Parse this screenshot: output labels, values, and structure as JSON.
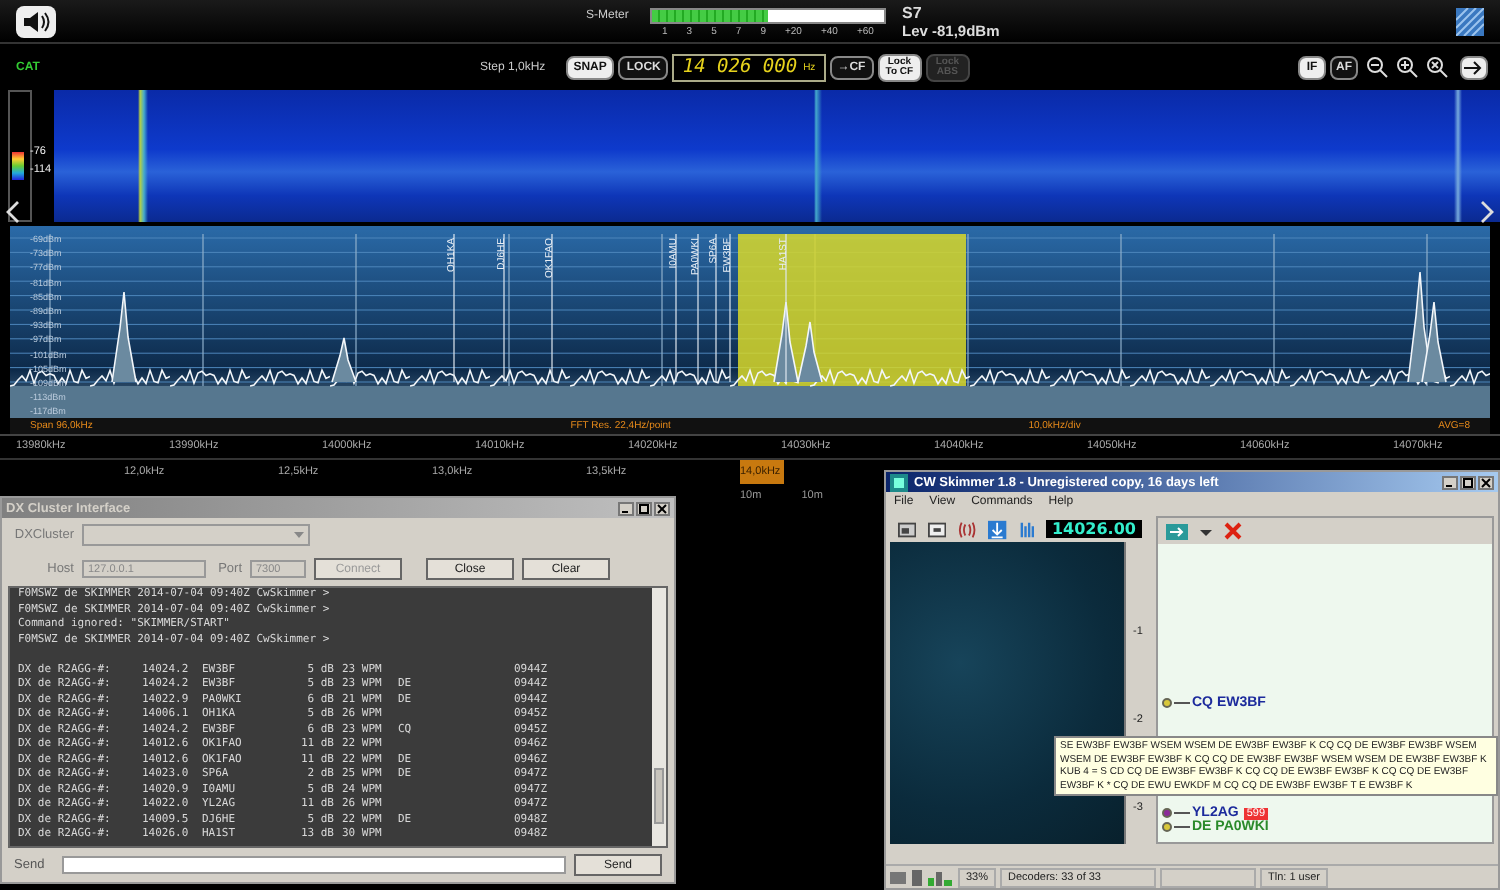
{
  "top_bar": {
    "s_meter_label": "S-Meter",
    "s_meter": {
      "level": 0.5
    },
    "s_meter_scale": [
      "1",
      "3",
      "5",
      "7",
      "9",
      "+20",
      "+40",
      "+60"
    ],
    "s_reading": "S7",
    "level_reading": "Lev -81,9dBm"
  },
  "control_bar": {
    "cat": "CAT",
    "step": "Step 1,0kHz",
    "toggles": [
      {
        "label": "SNAP",
        "selected": true
      },
      {
        "label": "LOCK",
        "selected": false
      }
    ],
    "frequency": "14 026 000",
    "unit": "Hz",
    "to_cf": "→CF",
    "lock_to_cf": "Lock To CF",
    "lock_abs": {
      "label": "Lock ABS",
      "disabled": true
    },
    "modes": [
      {
        "label": "IF",
        "selected": true
      },
      {
        "label": "AF",
        "selected": false
      }
    ]
  },
  "waterfall": {
    "scale": [
      "-76",
      "-114"
    ]
  },
  "spectrum": {
    "db_labels": [
      "-69dBm",
      "-73dBm",
      "-77dBm",
      "-81dBm",
      "-85dBm",
      "-89dBm",
      "-93dBm",
      "-97dBm",
      "-101dBm",
      "-105dBm",
      "-109dBm",
      "-113dBm",
      "-117dBm"
    ],
    "markers": [
      "OH1KA",
      "DJ6HE",
      "OK1FAO",
      "I0AMU",
      "PA0WKI",
      "SP6A",
      "EW3BF",
      "HA1ST"
    ],
    "span": "Span 96,0kHz",
    "fft": "FFT Res. 22,4Hz/point",
    "division": "10,0kHz/div",
    "avg": "AVG=8",
    "freq_ticks": [
      "13980kHz",
      "13990kHz",
      "14000kHz",
      "14010kHz",
      "14020kHz",
      "14030kHz",
      "14040kHz",
      "14050kHz",
      "14060kHz",
      "14070kHz"
    ],
    "if_ticks": [
      "12,0kHz",
      "12,5kHz",
      "13,0kHz",
      "13,5kHz",
      "14,0kHz"
    ],
    "band_ticks": [
      "10m",
      "10m"
    ]
  },
  "dx_cluster": {
    "title": "DX Cluster Interface",
    "dxcluster_label": "DXCluster",
    "host_label": "Host",
    "host": "127.0.0.1",
    "port_label": "Port",
    "port": "7300",
    "connect": {
      "label": "Connect",
      "disabled": true
    },
    "close": "Close",
    "clear": "Clear",
    "lines": [
      "F0MSWZ de SKIMMER 2014-07-04 09:40Z CwSkimmer >",
      "F0MSWZ de SKIMMER 2014-07-04 09:40Z CwSkimmer >",
      "Command ignored: \"SKIMMER/START\"",
      "F0MSWZ de SKIMMER 2014-07-04 09:40Z CwSkimmer >"
    ],
    "spots": [
      {
        "spotter": "DX de R2AGG-#:",
        "freq": "14024.2",
        "call": "EW3BF",
        "snr": "5 dB",
        "speed": "23 WPM",
        "time": "0944Z"
      },
      {
        "spotter": "DX de R2AGG-#:",
        "freq": "14024.2",
        "call": "EW3BF",
        "snr": "5 dB",
        "speed": "23 WPM",
        "info": "DE",
        "time": "0944Z"
      },
      {
        "spotter": "DX de R2AGG-#:",
        "freq": "14022.9",
        "call": "PA0WKI",
        "snr": "6 dB",
        "speed": "21 WPM",
        "info": "DE",
        "time": "0944Z"
      },
      {
        "spotter": "DX de R2AGG-#:",
        "freq": "14006.1",
        "call": "OH1KA",
        "snr": "5 dB",
        "speed": "26 WPM",
        "time": "0945Z"
      },
      {
        "spotter": "DX de R2AGG-#:",
        "freq": "14024.2",
        "call": "EW3BF",
        "snr": "6 dB",
        "speed": "23 WPM",
        "info": "CQ",
        "time": "0945Z"
      },
      {
        "spotter": "DX de R2AGG-#:",
        "freq": "14012.6",
        "call": "OK1FAO",
        "snr": "11 dB",
        "speed": "22 WPM",
        "time": "0946Z"
      },
      {
        "spotter": "DX de R2AGG-#:",
        "freq": "14012.6",
        "call": "OK1FAO",
        "snr": "11 dB",
        "speed": "22 WPM",
        "info": "DE",
        "time": "0946Z"
      },
      {
        "spotter": "DX de R2AGG-#:",
        "freq": "14023.0",
        "call": "SP6A",
        "snr": "2 dB",
        "speed": "25 WPM",
        "info": "DE",
        "time": "0947Z"
      },
      {
        "spotter": "DX de R2AGG-#:",
        "freq": "14020.9",
        "call": "I0AMU",
        "snr": "5 dB",
        "speed": "24 WPM",
        "time": "0947Z"
      },
      {
        "spotter": "DX de R2AGG-#:",
        "freq": "14022.0",
        "call": "YL2AG",
        "snr": "11 dB",
        "speed": "26 WPM",
        "time": "0947Z"
      },
      {
        "spotter": "DX de R2AGG-#:",
        "freq": "14009.5",
        "call": "DJ6HE",
        "snr": "5 dB",
        "speed": "22 WPM",
        "info": "DE",
        "time": "0948Z"
      },
      {
        "spotter": "DX de R2AGG-#:",
        "freq": "14026.0",
        "call": "HA1ST",
        "snr": "13 dB",
        "speed": "30 WPM",
        "time": "0948Z"
      }
    ],
    "send_label": "Send",
    "send_button": "Send"
  },
  "cw_skimmer": {
    "title": "CW Skimmer 1.8 - Unregistered copy, 16 days left",
    "menu": [
      "File",
      "View",
      "Commands",
      "Help"
    ],
    "frequency": "14026.00",
    "scale": [
      "-1",
      "-2",
      "-3"
    ],
    "decodes": [
      {
        "text": "CQ EW3BF",
        "color": "#1c2a9c"
      },
      {
        "text": "YL2AG",
        "color": "#1c2a9c",
        "badge": "599"
      },
      {
        "text": "DE PA0WKI",
        "color": "#2a8a2a"
      }
    ],
    "tooltip": "SE EW3BF EW3BF WSEM WSEM DE EW3BF EW3BF K CQ CQ DE EW3BF EW3BF WSEM WSEM DE EW3BF EW3BF K CQ CQ DE EW3BF EW3BF WSEM WSEM DE EW3BF EW3BF K KUB 4 = S CD CQ DE EW3BF EW3BF K CQ CQ DE EW3BF EW3BF K CQ CQ DE EW3BF EW3BF K * CQ DE EWU EWKDF M CQ CQ DE EW3BF EW3BF T E EW3BF K",
    "status": {
      "cpu": "33%",
      "decoders": "Decoders: 33 of 33",
      "telnet": "Tln: 1 user"
    }
  }
}
